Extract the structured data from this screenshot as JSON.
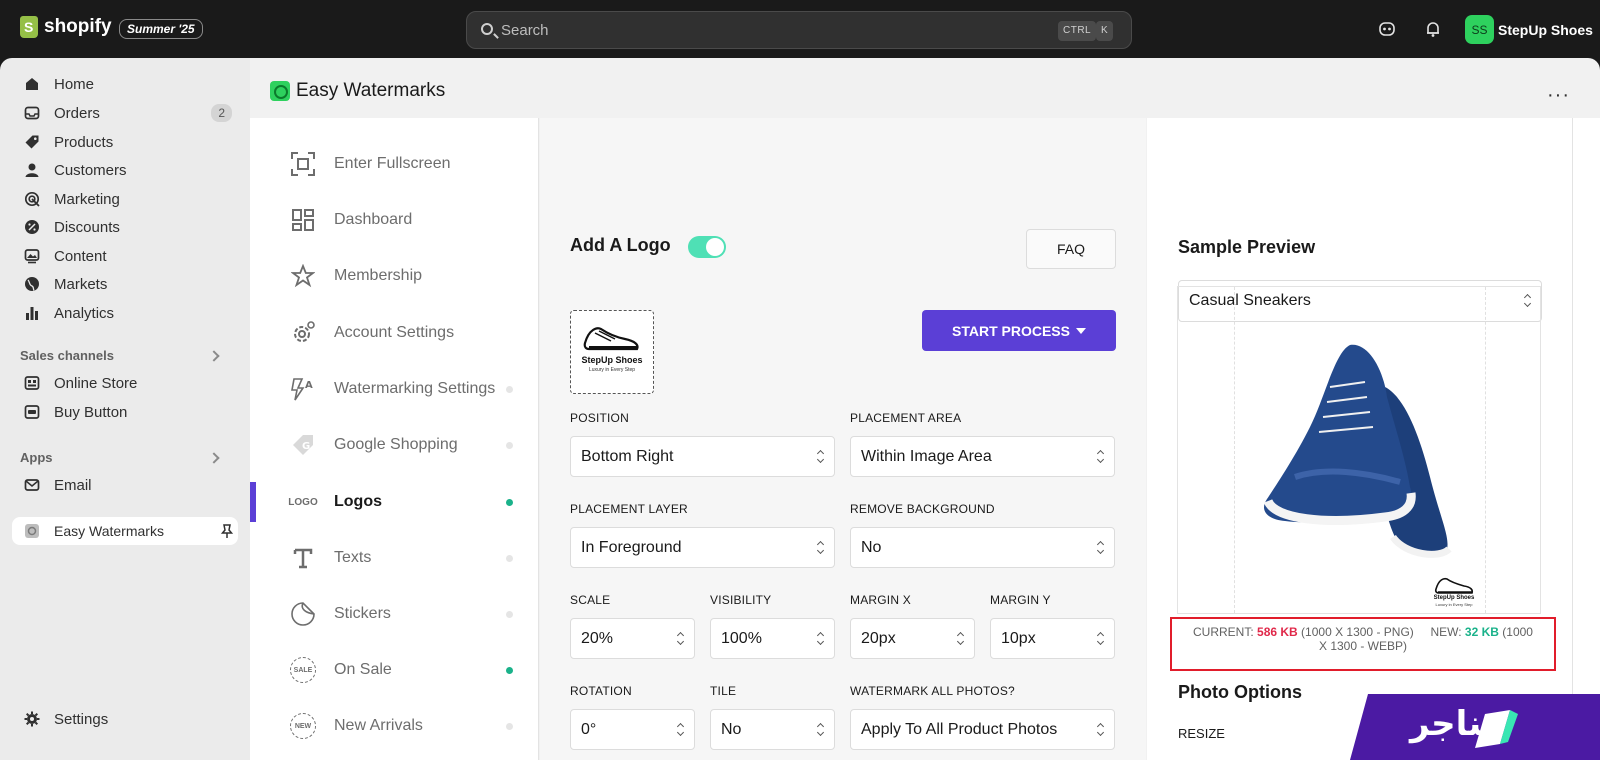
{
  "topbar": {
    "brand": "shopify",
    "edition": "Summer '25",
    "search_placeholder": "Search",
    "shortcut_ctrl": "CTRL",
    "shortcut_k": "K",
    "avatar_initials": "SS",
    "store_name": "StepUp Shoes"
  },
  "sidebar": {
    "items": [
      {
        "label": "Home",
        "icon": "home-icon"
      },
      {
        "label": "Orders",
        "icon": "orders-icon",
        "badge": "2"
      },
      {
        "label": "Products",
        "icon": "tag-icon"
      },
      {
        "label": "Customers",
        "icon": "person-icon"
      },
      {
        "label": "Marketing",
        "icon": "target-icon"
      },
      {
        "label": "Discounts",
        "icon": "discount-icon"
      },
      {
        "label": "Content",
        "icon": "content-icon"
      },
      {
        "label": "Markets",
        "icon": "globe-icon"
      },
      {
        "label": "Analytics",
        "icon": "bar-chart-icon"
      }
    ],
    "sales_channels_label": "Sales channels",
    "sales_channels": [
      {
        "label": "Online Store",
        "icon": "store-icon"
      },
      {
        "label": "Buy Button",
        "icon": "buy-button-icon"
      }
    ],
    "apps_label": "Apps",
    "apps": [
      {
        "label": "Email",
        "icon": "email-icon"
      },
      {
        "label": "Easy Watermarks",
        "icon": "app-icon"
      }
    ],
    "settings_label": "Settings"
  },
  "app": {
    "title": "Easy Watermarks",
    "nav": [
      {
        "label": "Enter Fullscreen",
        "icon": "fullscreen-icon"
      },
      {
        "label": "Dashboard",
        "icon": "dashboard-icon"
      },
      {
        "label": "Membership",
        "icon": "star-icon"
      },
      {
        "label": "Account Settings",
        "icon": "gear-icon"
      },
      {
        "label": "Watermarking Settings",
        "icon": "watermark-settings-icon"
      },
      {
        "label": "Google Shopping",
        "icon": "google-tag-icon"
      },
      {
        "label": "Logos",
        "icon": "logo-icon",
        "icon_text": "LOGO"
      },
      {
        "label": "Texts",
        "icon": "text-icon"
      },
      {
        "label": "Stickers",
        "icon": "sticker-icon"
      },
      {
        "label": "On Sale",
        "icon": "sale-badge-icon",
        "icon_text": "SALE"
      },
      {
        "label": "New Arrivals",
        "icon": "new-badge-icon",
        "icon_text": "NEW"
      }
    ]
  },
  "logo_panel": {
    "title": "Add A Logo",
    "toggle_on": true,
    "faq_label": "FAQ",
    "start_label": "START PROCESS",
    "logo_name": "StepUp Shoes",
    "logo_tagline": "Luxury in Every Step",
    "fields": {
      "position": {
        "label": "POSITION",
        "value": "Bottom Right"
      },
      "placement_area": {
        "label": "PLACEMENT AREA",
        "value": "Within Image Area"
      },
      "placement_layer": {
        "label": "PLACEMENT LAYER",
        "value": "In Foreground"
      },
      "remove_bg": {
        "label": "REMOVE BACKGROUND",
        "value": "No"
      },
      "scale": {
        "label": "SCALE",
        "value": "20%"
      },
      "visibility": {
        "label": "VISIBILITY",
        "value": "100%"
      },
      "margin_x": {
        "label": "MARGIN X",
        "value": "20px"
      },
      "margin_y": {
        "label": "MARGIN Y",
        "value": "10px"
      },
      "rotation": {
        "label": "ROTATION",
        "value": "0°"
      },
      "tile": {
        "label": "TILE",
        "value": "No"
      },
      "watermark_all": {
        "label": "WATERMARK ALL PHOTOS?",
        "value": "Apply To All Product Photos"
      }
    }
  },
  "preview": {
    "title": "Sample Preview",
    "product": "Casual Sneakers",
    "current_label": "CURRENT:",
    "current_size": "586 KB",
    "current_meta": "(1000 X 1300 - PNG)",
    "new_label": "NEW:",
    "new_size": "32 KB",
    "new_meta": "(1000 X 1300 - WEBP)",
    "watermark_name": "StepUp Shoes",
    "watermark_tagline": "Luxury in Every Step",
    "photo_options_title": "Photo Options",
    "resize_label": "RESIZE"
  },
  "corner_brand": "تناجر",
  "colors": {
    "accent": "#5b3fd6",
    "toggle": "#4fe0b5",
    "active_dot": "#1ab28a",
    "current_size": "#e0294a",
    "new_size": "#1ab28a",
    "avatar": "#2ed15e"
  }
}
